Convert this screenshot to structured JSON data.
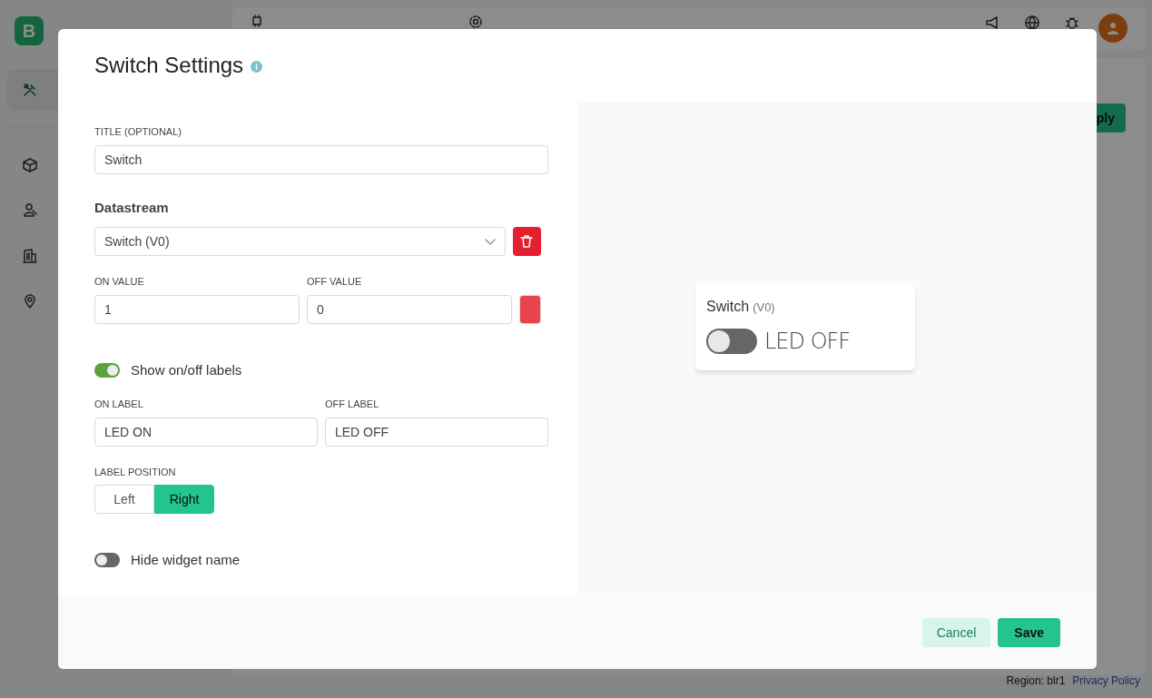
{
  "app": {
    "logo": "B",
    "apply_button": "ply",
    "sidebar": [
      {
        "selected": true
      },
      {
        "selected": false
      },
      {
        "selected": false
      },
      {
        "selected": false
      },
      {
        "selected": false
      }
    ],
    "footer": {
      "region": "Region: blr1",
      "privacy": "Privacy Policy"
    }
  },
  "dialog": {
    "title": "Switch Settings",
    "title_field": {
      "label": "TITLE (OPTIONAL)",
      "value": "Switch"
    },
    "datastream": {
      "heading": "Datastream",
      "value": "Switch (V0)"
    },
    "on_value": {
      "label": "ON VALUE",
      "value": "1"
    },
    "off_value": {
      "label": "OFF VALUE",
      "value": "0"
    },
    "color": "#e9434d",
    "show_labels": {
      "label": "Show on/off labels",
      "on": true
    },
    "on_label": {
      "label": "ON LABEL",
      "value": "LED ON"
    },
    "off_label": {
      "label": "OFF LABEL",
      "value": "LED OFF"
    },
    "label_position": {
      "label": "LABEL POSITION",
      "options": [
        {
          "label": "Left",
          "selected": false
        },
        {
          "label": "Right",
          "selected": true
        }
      ]
    },
    "hide_name": {
      "label": "Hide widget name",
      "on": false
    },
    "preview": {
      "name": "Switch",
      "pin": "(V0)",
      "on": false,
      "state_label": "LED OFF"
    },
    "buttons": {
      "cancel": "Cancel",
      "save": "Save"
    }
  }
}
